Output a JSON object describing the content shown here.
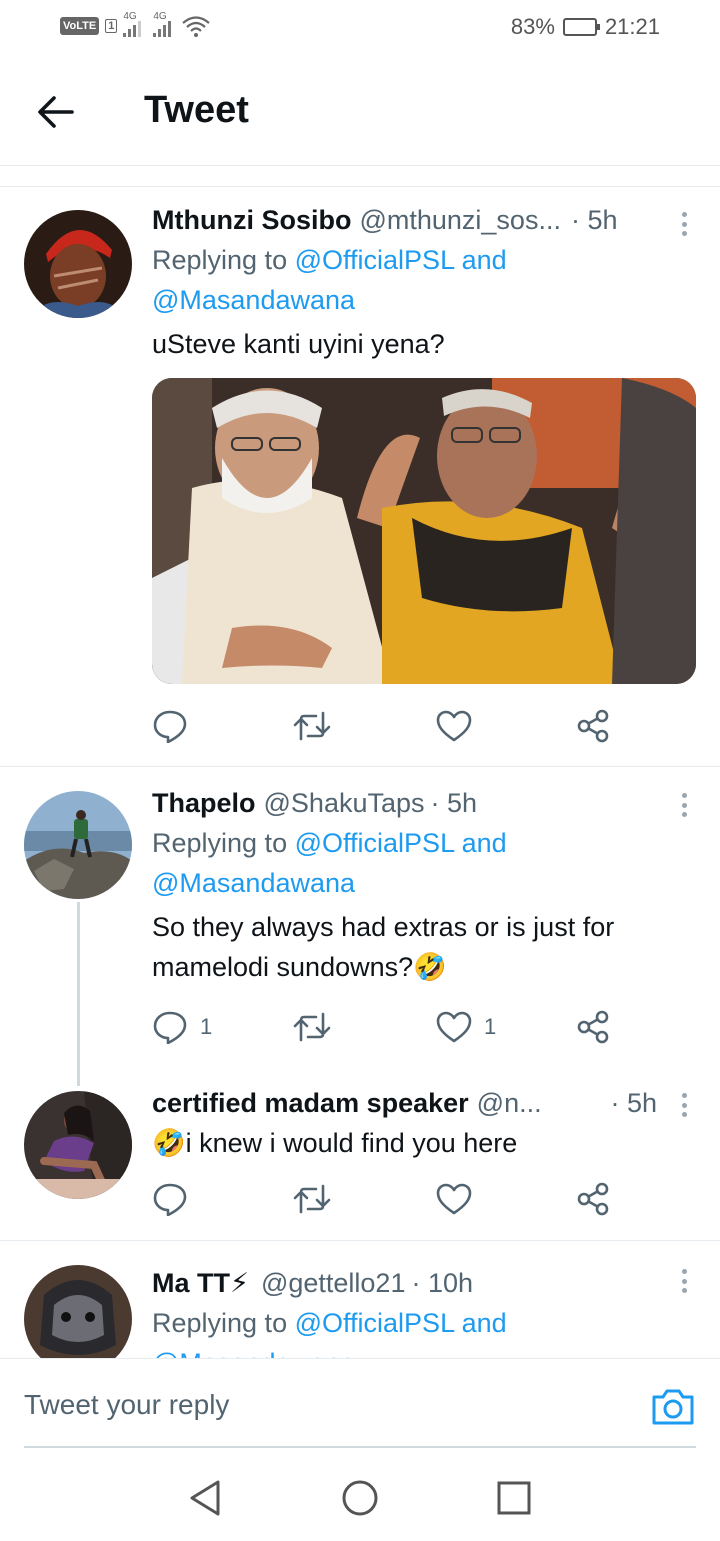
{
  "status_bar": {
    "network_1": "4G",
    "network_2": "4G",
    "sim_label": "1",
    "volte_label": "VoLTE",
    "battery": "83%",
    "battery_level": 0.83,
    "time": "21:21"
  },
  "header": {
    "title": "Tweet"
  },
  "tweets": [
    {
      "name": "Mthunzi Sosibo",
      "handle": "@mthunzi_sos...",
      "time": "· 5h",
      "reply_prefix": "Replying to",
      "reply_mention_1": "@OfficialPSL",
      "reply_and": "and",
      "reply_mention_2": "@Masandawana",
      "text": "uSteve kanti uyini yena?",
      "reply_count": "",
      "like_count": ""
    },
    {
      "name": "Thapelo",
      "handle": "@ShakuTaps",
      "time": "· 5h",
      "reply_prefix": "Replying to",
      "reply_mention_1": "@OfficialPSL",
      "reply_and": "and",
      "reply_mention_2": "@Masandawana",
      "text": "So they always had extras or is just for mamelodi sundowns?🤣",
      "reply_count": "1",
      "like_count": "1"
    },
    {
      "name": "certified madam speaker",
      "handle": "@n...",
      "time": "· 5h",
      "text": "🤣i knew i would find you here",
      "reply_count": "",
      "like_count": ""
    },
    {
      "name": "Ma TT⚡",
      "handle": "@gettello21",
      "time": "· 10h",
      "reply_prefix": "Replying to",
      "reply_mention_1": "@OfficialPSL",
      "reply_and": "and",
      "reply_mention_2": "@Masandawana"
    }
  ],
  "reply_bar": {
    "placeholder": "Tweet your reply"
  },
  "icons": {
    "back": "arrow-left-icon",
    "reply": "comment-icon",
    "retweet": "retweet-icon",
    "like": "heart-icon",
    "share": "share-icon",
    "more": "more-vertical-icon",
    "camera": "camera-icon"
  },
  "colors": {
    "link": "#1d9bf0",
    "secondary_text": "#536471",
    "primary_text": "#0f1419"
  }
}
